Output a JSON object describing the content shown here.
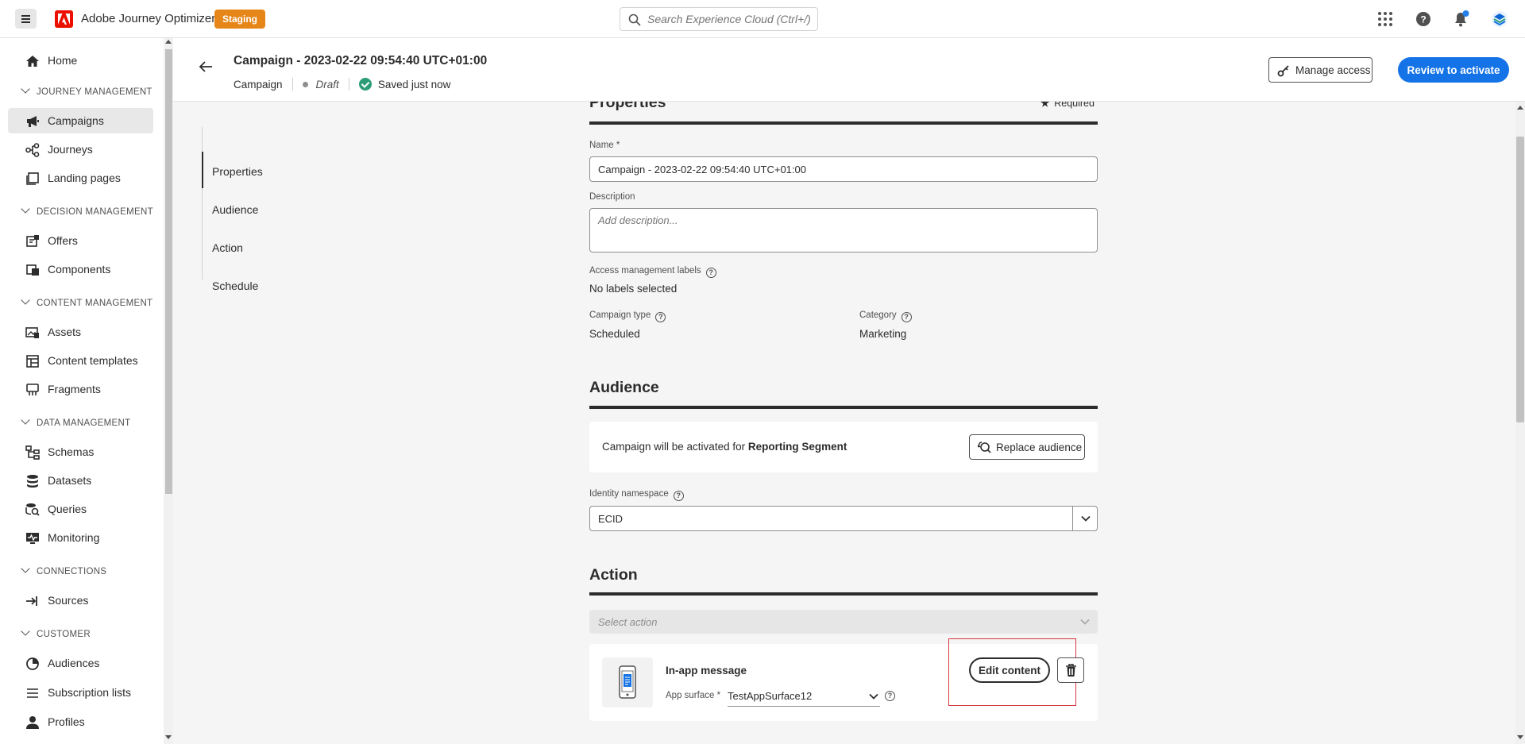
{
  "topbar": {
    "app_name": "Adobe Journey Optimizer",
    "env_badge": "Staging",
    "search_placeholder": "Search Experience Cloud (Ctrl+/)"
  },
  "sidebar": {
    "home": "Home",
    "sections": {
      "journey": "JOURNEY MANAGEMENT",
      "decision": "DECISION MANAGEMENT",
      "content": "CONTENT MANAGEMENT",
      "data": "DATA MANAGEMENT",
      "connections": "CONNECTIONS",
      "customer": "CUSTOMER"
    },
    "items": {
      "campaigns": "Campaigns",
      "journeys": "Journeys",
      "landing_pages": "Landing pages",
      "offers": "Offers",
      "components": "Components",
      "assets": "Assets",
      "content_templates": "Content templates",
      "fragments": "Fragments",
      "schemas": "Schemas",
      "datasets": "Datasets",
      "queries": "Queries",
      "monitoring": "Monitoring",
      "sources": "Sources",
      "audiences": "Audiences",
      "subscription_lists": "Subscription lists",
      "profiles": "Profiles"
    }
  },
  "header": {
    "title": "Campaign - 2023-02-22 09:54:40 UTC+01:00",
    "type": "Campaign",
    "status": "Draft",
    "saved": "Saved just now",
    "manage_access": "Manage access",
    "review": "Review to activate"
  },
  "toc": [
    "Properties",
    "Audience",
    "Action",
    "Schedule"
  ],
  "properties": {
    "heading": "Properties",
    "required": "Required",
    "name_label": "Name",
    "name_value": "Campaign - 2023-02-22 09:54:40 UTC+01:00",
    "desc_label": "Description",
    "desc_placeholder": "Add description...",
    "access_label": "Access management labels",
    "access_value": "No labels selected",
    "type_label": "Campaign type",
    "type_value": "Scheduled",
    "category_label": "Category",
    "category_value": "Marketing"
  },
  "audience": {
    "heading": "Audience",
    "text_prefix": "Campaign will be activated for",
    "segment": "Reporting Segment",
    "replace": "Replace audience",
    "namespace_label": "Identity namespace",
    "namespace_value": "ECID"
  },
  "action": {
    "heading": "Action",
    "select_placeholder": "Select action",
    "channel": "In-app message",
    "surface_label": "App surface",
    "surface_value": "TestAppSurface12",
    "edit": "Edit content"
  },
  "colors": {
    "accent": "#1473e6",
    "badge": "#e68619",
    "brand": "#eb1000",
    "success": "#2d9d78",
    "highlight": "#d7373f"
  }
}
